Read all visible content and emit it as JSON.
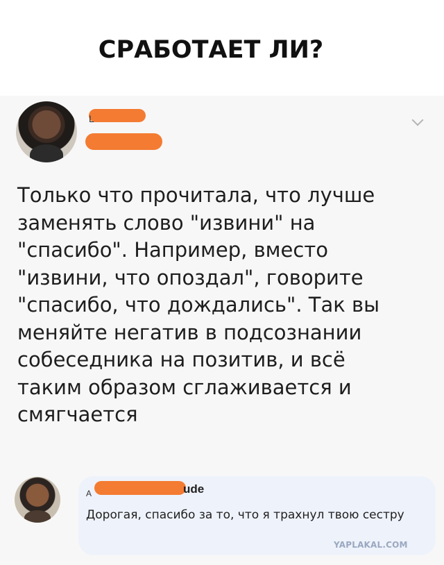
{
  "header": {
    "title": "СРАБОТАЕТ ЛИ?"
  },
  "post": {
    "author_partial": "L",
    "author_suffix": "",
    "body": "Только что прочитала, что лучше\nзаменять слово \"извини\" на\n\"спасибо\". Например, вместо\n\"извини, что опоздал\", говорите\n\"спасибо, что дождались\". Так вы\nменяйте негатив в подсознании\nсобеседника на позитив, и всё\nтаким образом сглаживается и\nсмягчается",
    "menu_icon": "chevron-down-icon"
  },
  "comment": {
    "author_suffix": "ude",
    "author_partial": "A",
    "text": "Дорогая, спасибо за то, что я трахнул твою сестру"
  },
  "watermark": {
    "text": "YAPLAKAL.COM"
  },
  "colors": {
    "redaction": "#f47b32",
    "comment_bg": "#eef2fa",
    "post_bg": "#f7f7f7"
  }
}
